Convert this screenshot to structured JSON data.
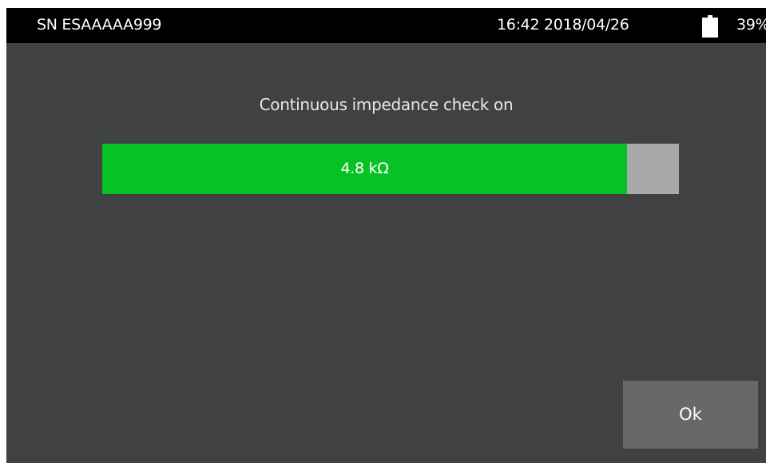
{
  "status_bar": {
    "serial": "SN ESAAAAA999",
    "datetime": "16:42 2018/04/26",
    "battery_level": 0.39,
    "battery_text": "39%",
    "battery_icon": "battery-icon"
  },
  "main": {
    "message": "Continuous impedance check on",
    "impedance": {
      "value_text": "4.8 kΩ",
      "fill_fraction": 0.91,
      "fill_color": "#07c224",
      "track_color": "#a9a9a9"
    }
  },
  "actions": {
    "ok_label": "Ok"
  }
}
